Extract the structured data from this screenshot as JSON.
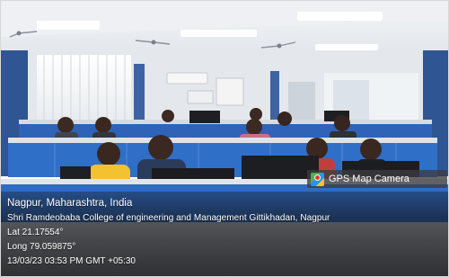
{
  "photo": {
    "scene": "computer-lab-with-students"
  },
  "overlay": {
    "badge_label": "GPS Map Camera",
    "badge_icon": "map-pin-icon",
    "city_line": "Nagpur, Maharashtra, India",
    "address_line": "Shri Ramdeobaba College of engineering and Management Gittikhadan, Nagpur",
    "lat_line": "Lat 21.17554°",
    "long_line": "Long 79.059875°",
    "timestamp_line": "13/03/23 03:53 PM GMT +05:30"
  },
  "colors": {
    "ceiling": "#e9ecef",
    "wall_blue": "#3a64a8",
    "desk_panel": "#2f6fc8",
    "overlay_text": "#ffffff"
  }
}
